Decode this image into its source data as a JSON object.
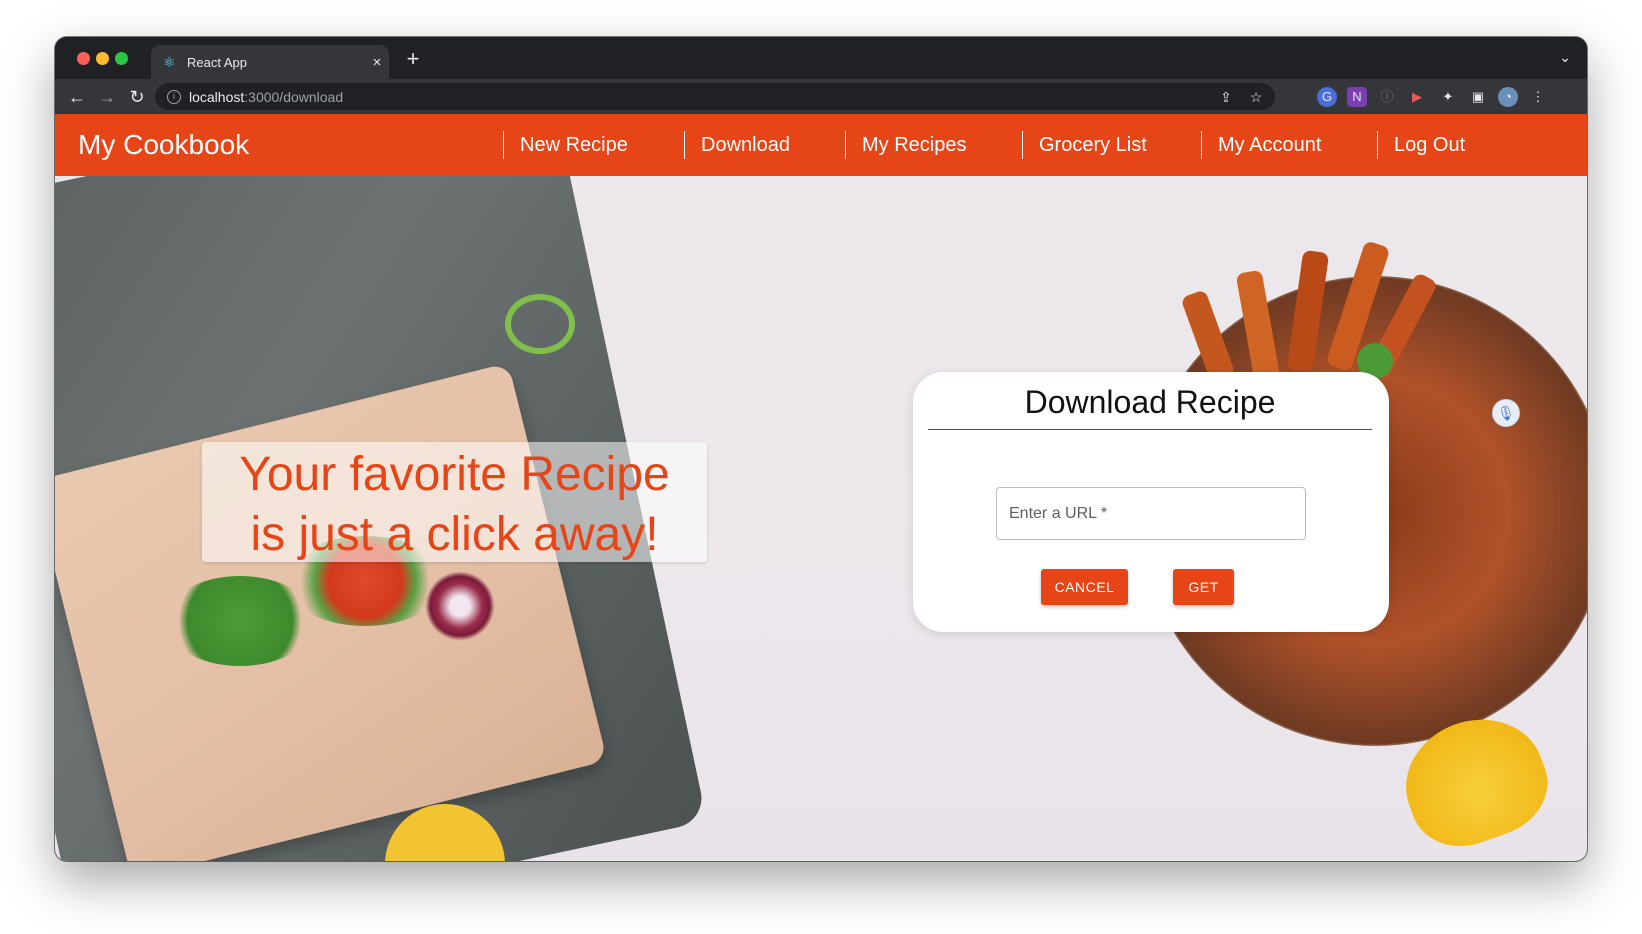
{
  "browser": {
    "tab_title": "React App",
    "tab_close": "×",
    "new_tab": "+",
    "tab_menu": "⌄",
    "url_host": "localhost",
    "url_path": ":3000/download",
    "nav": {
      "back": "←",
      "forward": "→",
      "reload": "↻"
    },
    "icons": {
      "share": "⇪",
      "star": "☆",
      "more": "⋮"
    },
    "extensions": [
      "G",
      "N",
      "ⓘ",
      "▶",
      "✦",
      "▣",
      "◔"
    ]
  },
  "app": {
    "brand": "My Cookbook",
    "accent_color": "#e64518",
    "nav_items": [
      {
        "label": "New Recipe"
      },
      {
        "label": "Download"
      },
      {
        "label": "My Recipes"
      },
      {
        "label": "Grocery List"
      },
      {
        "label": "My Account"
      },
      {
        "label": "Log Out"
      }
    ]
  },
  "hero": {
    "tagline_line1": "Your favorite Recipe",
    "tagline_line2": "is just a click away!"
  },
  "dialog": {
    "title": "Download Recipe",
    "url_placeholder": "Enter a URL *",
    "url_value": "",
    "cancel_label": "CANCEL",
    "get_label": "GET"
  }
}
